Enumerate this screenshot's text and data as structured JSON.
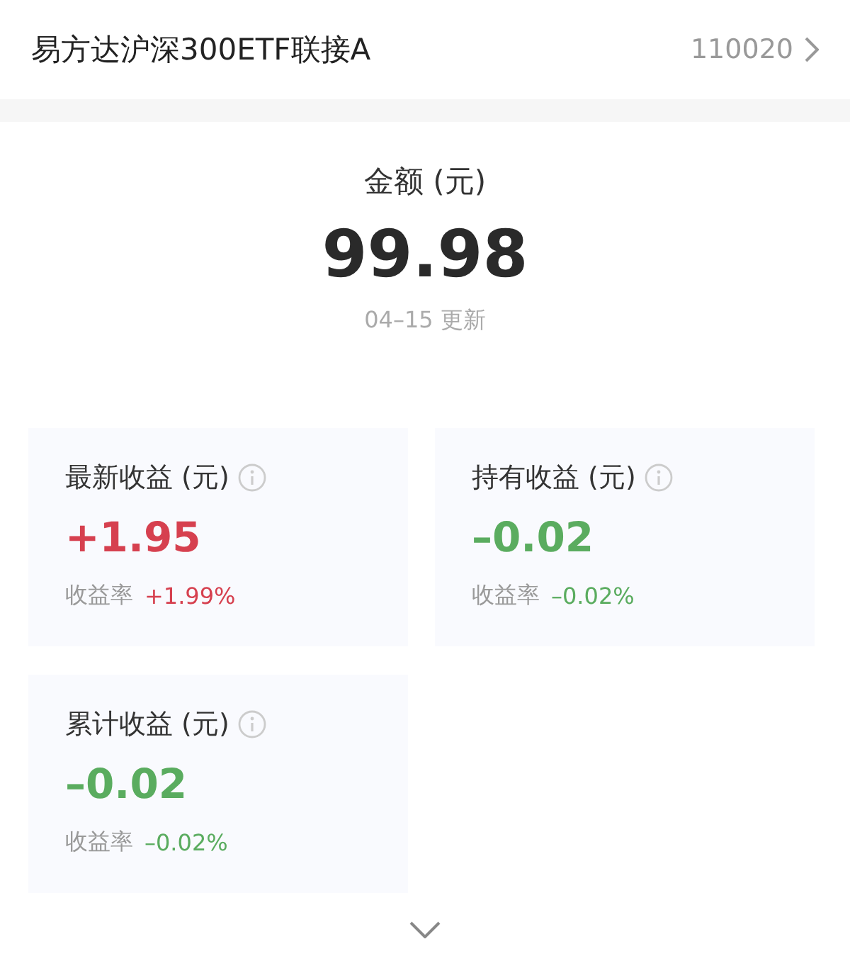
{
  "header": {
    "fund_name": "易方达沪深300ETF联接A",
    "fund_code": "110020"
  },
  "amount": {
    "label": "金额 (元)",
    "value": "99.98",
    "updated": "04–15 更新"
  },
  "cards": [
    {
      "title": "最新收益 (元)",
      "value": "+1.95",
      "rate_label": "收益率",
      "rate": "+1.99%",
      "kind": "gain"
    },
    {
      "title": "持有收益 (元)",
      "value": "–0.02",
      "rate_label": "收益率",
      "rate": "–0.02%",
      "kind": "loss"
    },
    {
      "title": "累计收益 (元)",
      "value": "–0.02",
      "rate_label": "收益率",
      "rate": "–0.02%",
      "kind": "loss"
    }
  ]
}
